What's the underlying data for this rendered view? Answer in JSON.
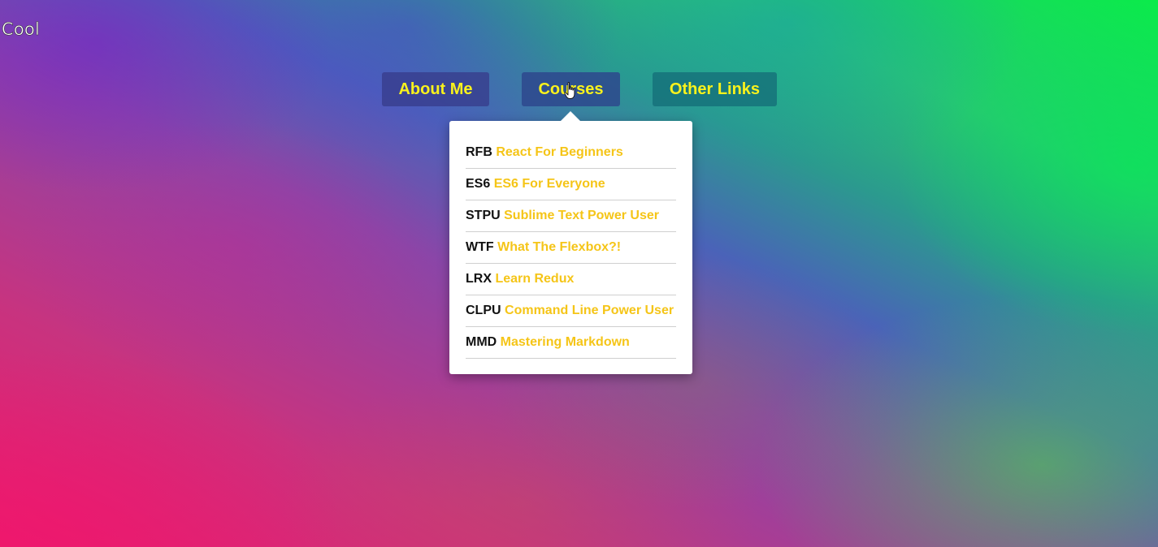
{
  "brand": {
    "title": "Cool"
  },
  "nav": {
    "items": [
      {
        "label": "About Me"
      },
      {
        "label": "Courses"
      },
      {
        "label": "Other Links"
      }
    ]
  },
  "courses": [
    {
      "code": "RFB",
      "name": "React For Beginners"
    },
    {
      "code": "ES6",
      "name": "ES6 For Everyone"
    },
    {
      "code": "STPU",
      "name": "Sublime Text Power User"
    },
    {
      "code": "WTF",
      "name": "What The Flexbox?!"
    },
    {
      "code": "LRX",
      "name": "Learn Redux"
    },
    {
      "code": "CLPU",
      "name": "Command Line Power User"
    },
    {
      "code": "MMD",
      "name": "Mastering Markdown"
    }
  ],
  "colors": {
    "nav_text": "#f9f21c",
    "course_name": "#f5c518",
    "course_code": "#111111",
    "dropdown_bg": "#ffffff"
  },
  "icons": {
    "cursor": "pointer-hand-icon"
  }
}
